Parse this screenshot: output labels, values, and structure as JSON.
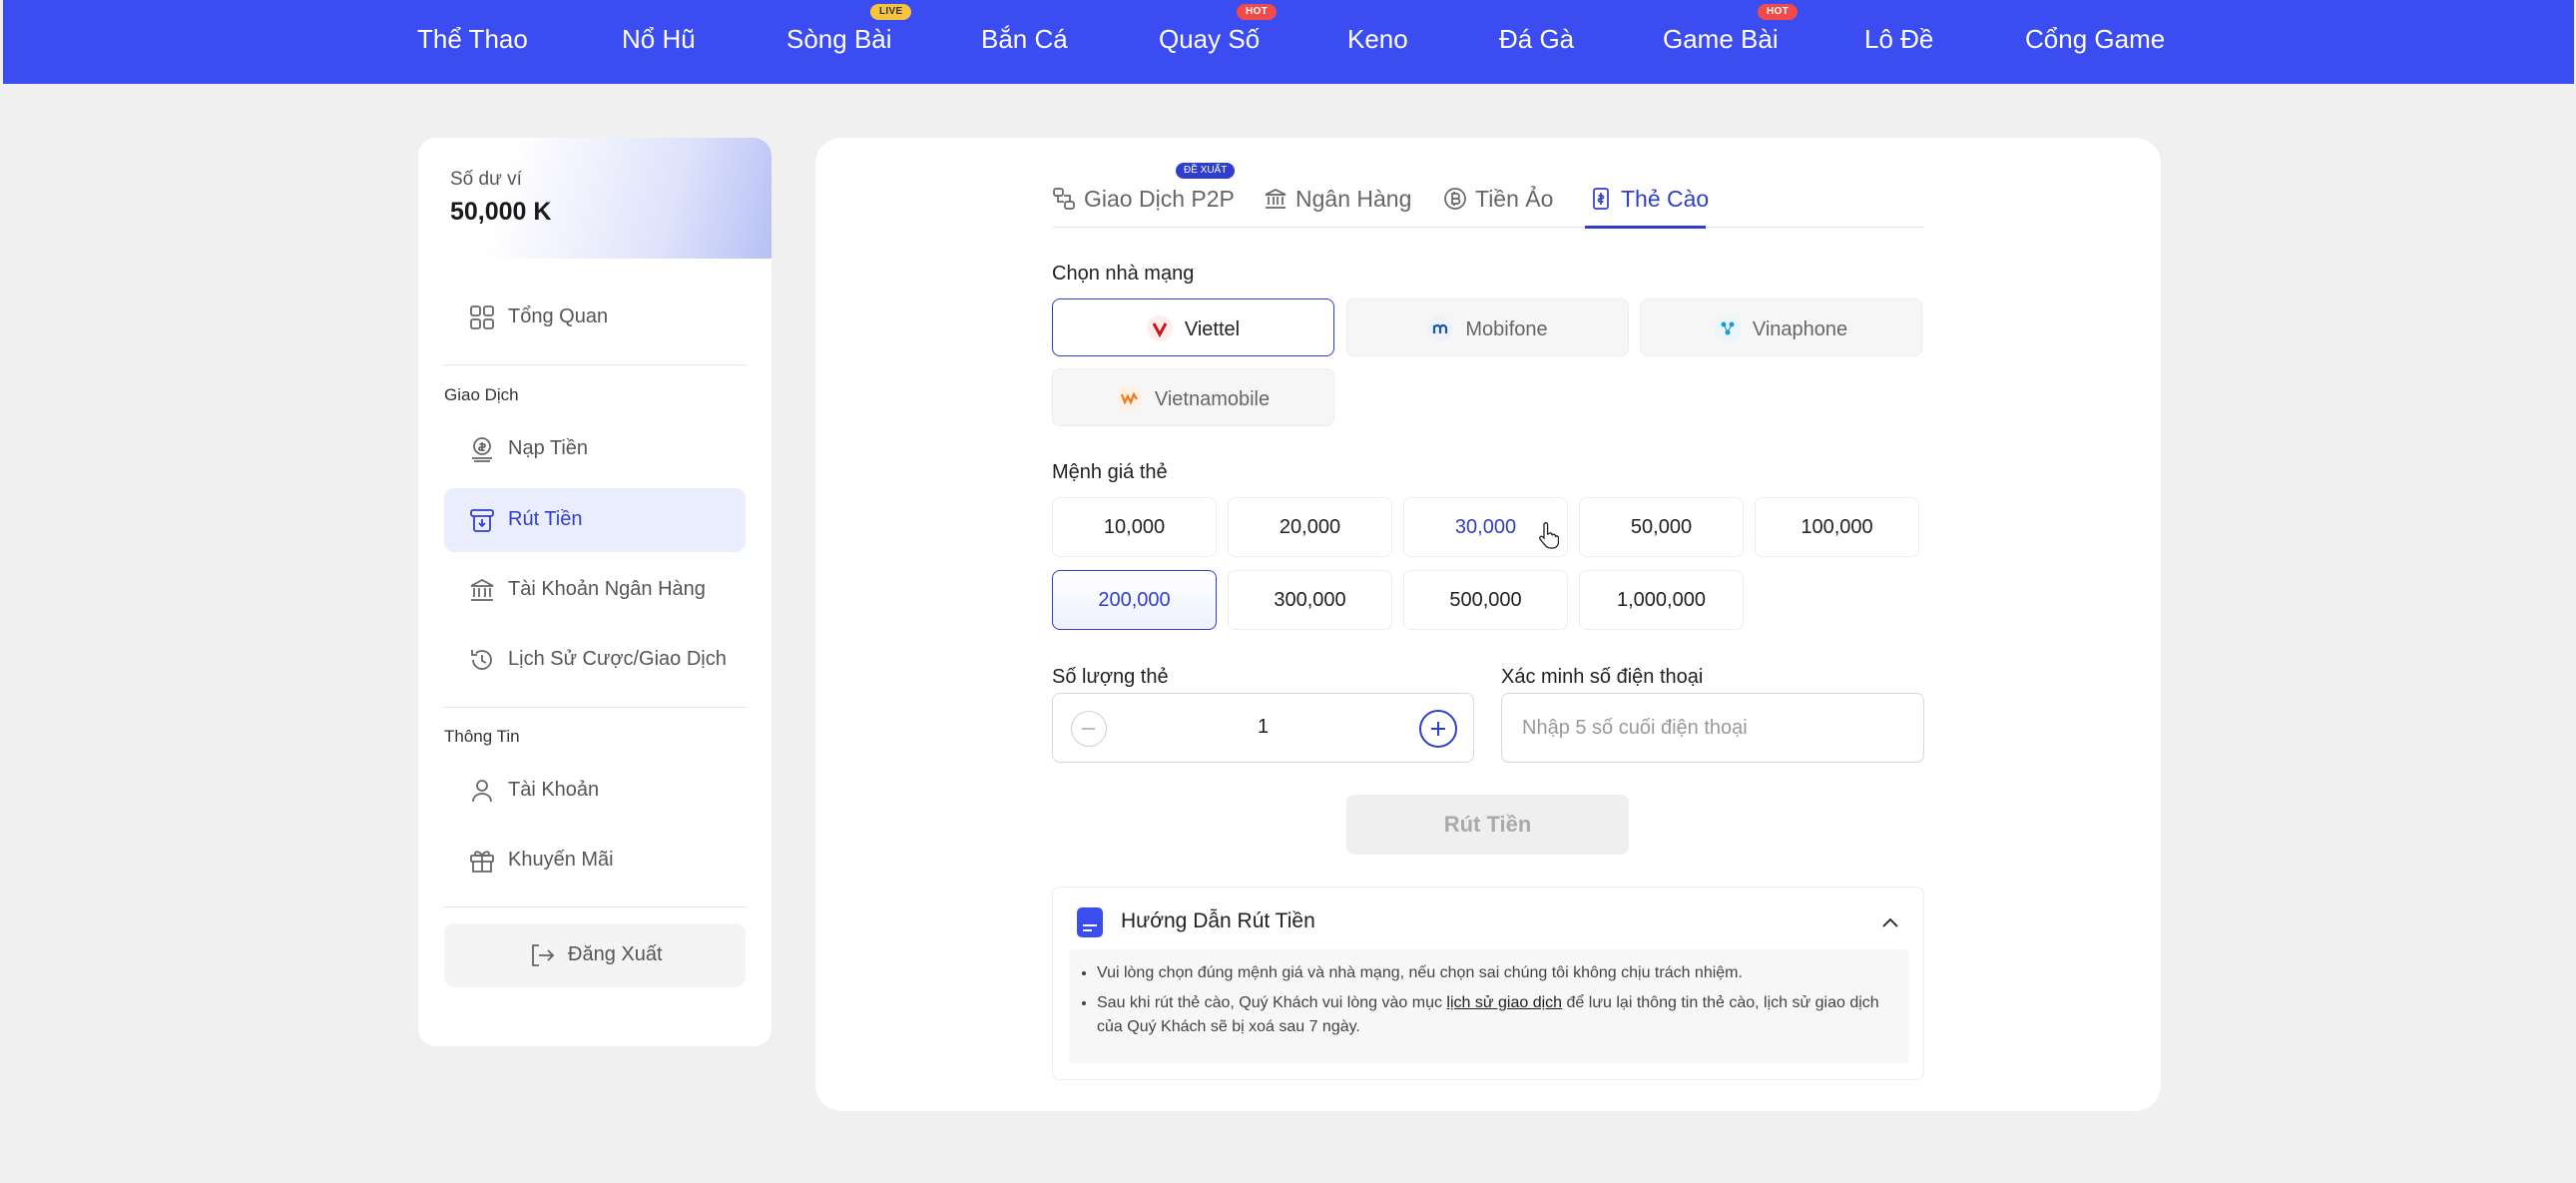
{
  "nav": {
    "items": [
      {
        "label": "Thể Thao"
      },
      {
        "label": "Nổ Hũ"
      },
      {
        "label": "Sòng Bài",
        "badge": "LIVE"
      },
      {
        "label": "Bắn Cá"
      },
      {
        "label": "Quay Số",
        "badge": "HOT"
      },
      {
        "label": "Keno"
      },
      {
        "label": "Đá Gà"
      },
      {
        "label": "Game Bài",
        "badge": "HOT"
      },
      {
        "label": "Lô Đề"
      },
      {
        "label": "Cổng Game"
      }
    ]
  },
  "wallet": {
    "label": "Số dư ví",
    "value": "50,000 K"
  },
  "sidebar": {
    "overview": "Tổng Quan",
    "section_transactions": "Giao Dịch",
    "deposit": "Nạp Tiền",
    "withdraw": "Rút Tiền",
    "bank_account": "Tài Khoản Ngân Hàng",
    "history": "Lịch Sử Cược/Giao Dịch",
    "section_info": "Thông Tin",
    "account": "Tài Khoản",
    "promotions": "Khuyến Mãi",
    "logout": "Đăng Xuất"
  },
  "tabs": {
    "p2p": "Giao Dịch P2P",
    "p2p_badge": "ĐỀ XUẤT",
    "bank": "Ngân Hàng",
    "crypto": "Tiền Ảo",
    "card": "Thẻ Cào",
    "active": "Thẻ Cào"
  },
  "form": {
    "carrier_label": "Chọn nhà mạng",
    "carriers": [
      "Viettel",
      "Mobifone",
      "Vinaphone",
      "Vietnamobile"
    ],
    "selected_carrier": "Viettel",
    "denomination_label": "Mệnh giá thẻ",
    "denominations": [
      "10,000",
      "20,000",
      "30,000",
      "50,000",
      "100,000",
      "200,000",
      "300,000",
      "500,000",
      "1,000,000"
    ],
    "selected_denomination": "200,000",
    "quantity_label": "Số lượng thẻ",
    "quantity": "1",
    "phone_label": "Xác minh số điện thoại",
    "phone_placeholder": "Nhập 5 số cuối điện thoại",
    "submit": "Rút Tiền"
  },
  "guide": {
    "title": "Hướng Dẫn Rút Tiền",
    "line1": "Vui lòng chọn đúng mệnh giá và nhà mạng, nếu chọn sai chúng tôi không chịu trách nhiệm.",
    "line2_pre": "Sau khi rút thẻ cào, Quý Khách vui lòng vào mục ",
    "line2_link": "lịch sử giao dịch",
    "line2_post": " để lưu lại thông tin thẻ cào, lịch sử giao dịch của Quý Khách sẽ bị xoá sau 7 ngày."
  },
  "colors": {
    "accent": "#2f3ed1",
    "nav_bg": "#3b4cf0",
    "badge_hot": "#f04a4a",
    "badge_live": "#f7c53b"
  }
}
